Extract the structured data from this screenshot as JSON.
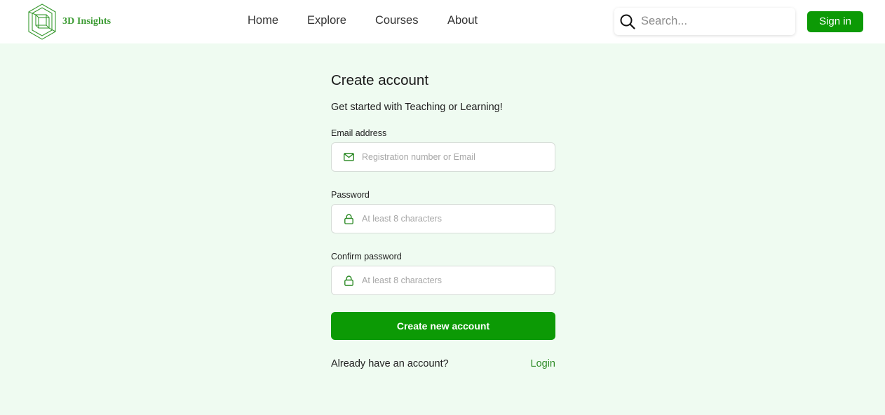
{
  "header": {
    "logo_text": "3D Insights",
    "nav": [
      "Home",
      "Explore",
      "Courses",
      "About"
    ],
    "search_placeholder": "Search...",
    "signin_label": "Sign in"
  },
  "form": {
    "title": "Create account",
    "subtitle": "Get started with Teaching or Learning!",
    "email_label": "Email address",
    "email_placeholder": "Registration number or Email",
    "password_label": "Password",
    "password_placeholder": "At least 8 characters",
    "confirm_label": "Confirm password",
    "confirm_placeholder": "At least 8 characters",
    "submit_label": "Create new account",
    "already_text": "Already have an account?",
    "login_label": "Login"
  },
  "colors": {
    "accent": "#0c9a05",
    "page_background": "#effbf1",
    "logo_green": "#3a9a31"
  },
  "icons": {
    "logo": "cube-hexagon-logo",
    "search": "search-icon",
    "email": "mail-icon",
    "password": "lock-icon"
  }
}
